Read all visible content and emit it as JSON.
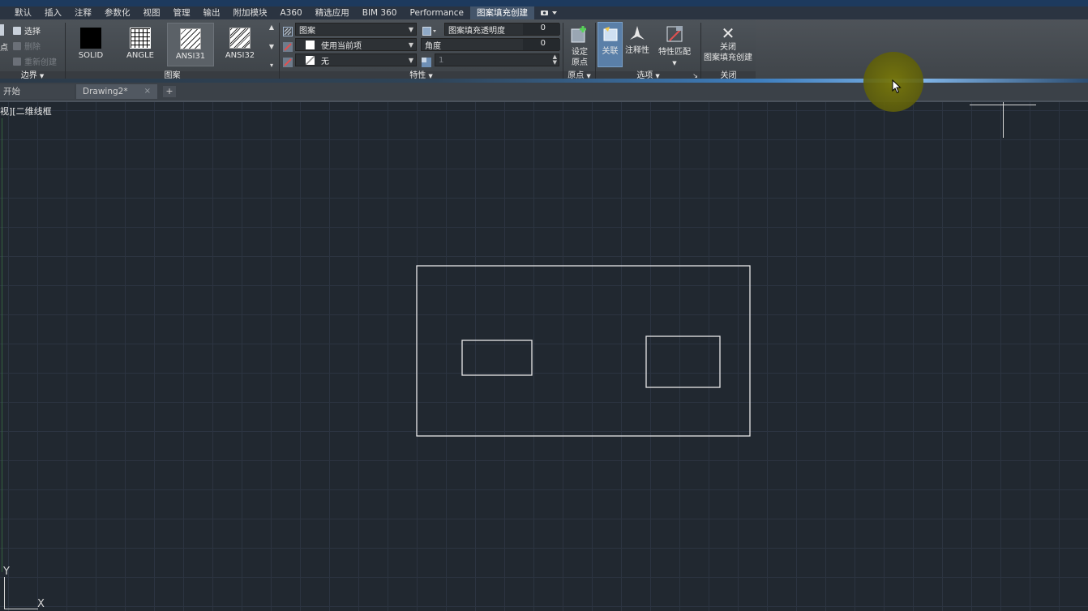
{
  "menu": {
    "items": [
      "默认",
      "插入",
      "注释",
      "参数化",
      "视图",
      "管理",
      "输出",
      "附加模块",
      "A360",
      "精选应用",
      "BIM 360",
      "Performance",
      "图案填充创建"
    ],
    "active_index": 12
  },
  "boundary_panel": {
    "select_label": "选择",
    "delete_label": "删除",
    "recreate_label": "重新创建",
    "left_cut_label": "点",
    "title": "边界"
  },
  "pattern_panel": {
    "title": "图案",
    "patterns": [
      {
        "label": "SOLID"
      },
      {
        "label": "ANGLE"
      },
      {
        "label": "ANSI31"
      },
      {
        "label": "ANSI32"
      }
    ],
    "selected_index": 2
  },
  "properties_panel": {
    "title": "特性",
    "hatch_type": "图案",
    "color": "使用当前项",
    "background": "无",
    "transparency_label": "图案填充透明度",
    "transparency_value": "0",
    "angle_label": "角度",
    "angle_value": "0",
    "scale_value": "1"
  },
  "origin_panel": {
    "set_origin_line1": "设定",
    "set_origin_line2": "原点",
    "title": "原点"
  },
  "options_panel": {
    "associative_label": "关联",
    "annotative_label": "注释性",
    "match_label": "特性匹配",
    "title": "选项"
  },
  "close_panel": {
    "close_line1": "关闭",
    "close_line2": "图案填充创建",
    "title": "关闭"
  },
  "tabs": {
    "start_label": "开始",
    "drawing_label": "Drawing2*",
    "close_glyph": "×",
    "add_glyph": "+"
  },
  "viewport": {
    "label": "视][二维线框"
  },
  "ucs": {
    "x_label": "X",
    "y_label": "Y"
  },
  "colors": {
    "accent_selected": "#5a7fa8",
    "canvas_bg": "#212830",
    "cursor_highlight": "#7a7a0a"
  }
}
